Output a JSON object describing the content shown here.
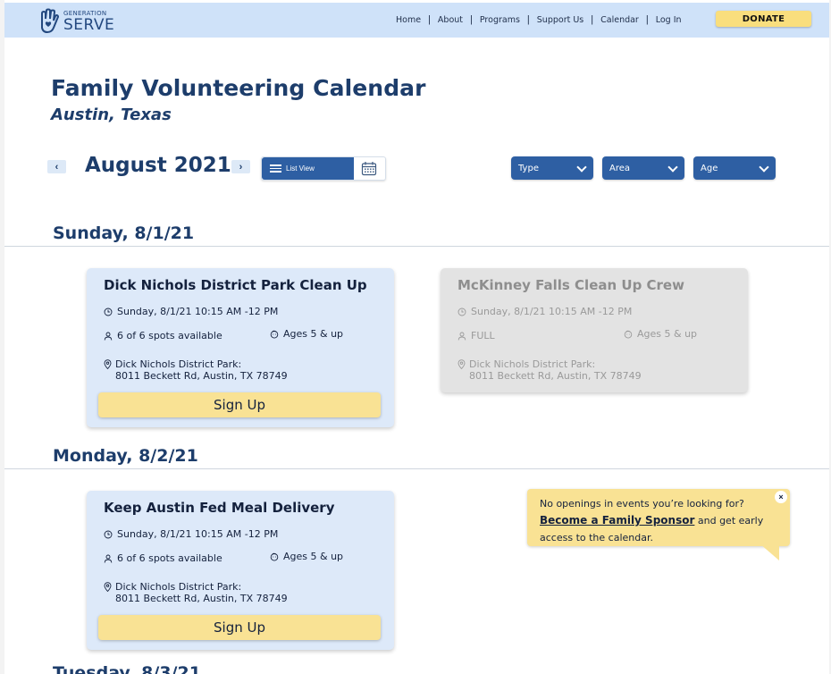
{
  "header": {
    "logo_small": "GENERATION",
    "logo_big": "SERVE",
    "nav": [
      "Home",
      "About",
      "Programs",
      "Support Us",
      "Calendar",
      "Log In"
    ],
    "donate": "DONATE"
  },
  "title": "Family Volunteering Calendar",
  "subtitle": "Austin, Texas",
  "month_label": "August 2021",
  "view_toggle": {
    "list_label": "List View"
  },
  "filters": [
    "Type",
    "Area",
    "Age"
  ],
  "days": [
    {
      "heading": "Sunday, 8/1/21",
      "events": [
        {
          "title": "Dick Nichols District Park Clean Up",
          "datetime": "Sunday, 8/1/21 10:15 AM -12 PM",
          "spots": "6 of 6 spots available",
          "ages": "Ages 5 & up",
          "address_line1": "Dick Nichols District Park:",
          "address_line2": "8011 Beckett Rd, Austin, TX 78749",
          "button": "Sign Up"
        },
        {
          "title": "McKinney Falls Clean Up Crew",
          "datetime": "Sunday, 8/1/21 10:15 AM -12 PM",
          "spots": "FULL",
          "ages": "Ages 5 & up",
          "address_line1": "Dick Nichols District Park:",
          "address_line2": "8011 Beckett Rd, Austin, TX 78749"
        }
      ]
    },
    {
      "heading": "Monday, 8/2/21",
      "events": [
        {
          "title": "Keep Austin Fed Meal Delivery",
          "datetime": "Sunday, 8/1/21 10:15 AM -12 PM",
          "spots": "6 of 6 spots available",
          "ages": "Ages 5 & up",
          "address_line1": "Dick Nichols District Park:",
          "address_line2": "8011 Beckett Rd, Austin, TX 78749",
          "button": "Sign Up"
        }
      ]
    }
  ],
  "promo": {
    "line1": "No openings in events you’re looking for?",
    "link": "Become a Family Sponsor",
    "line2": " and get early access to the calendar.",
    "close": "×"
  },
  "next_day_partial": "Tuesday, 8/3/21"
}
